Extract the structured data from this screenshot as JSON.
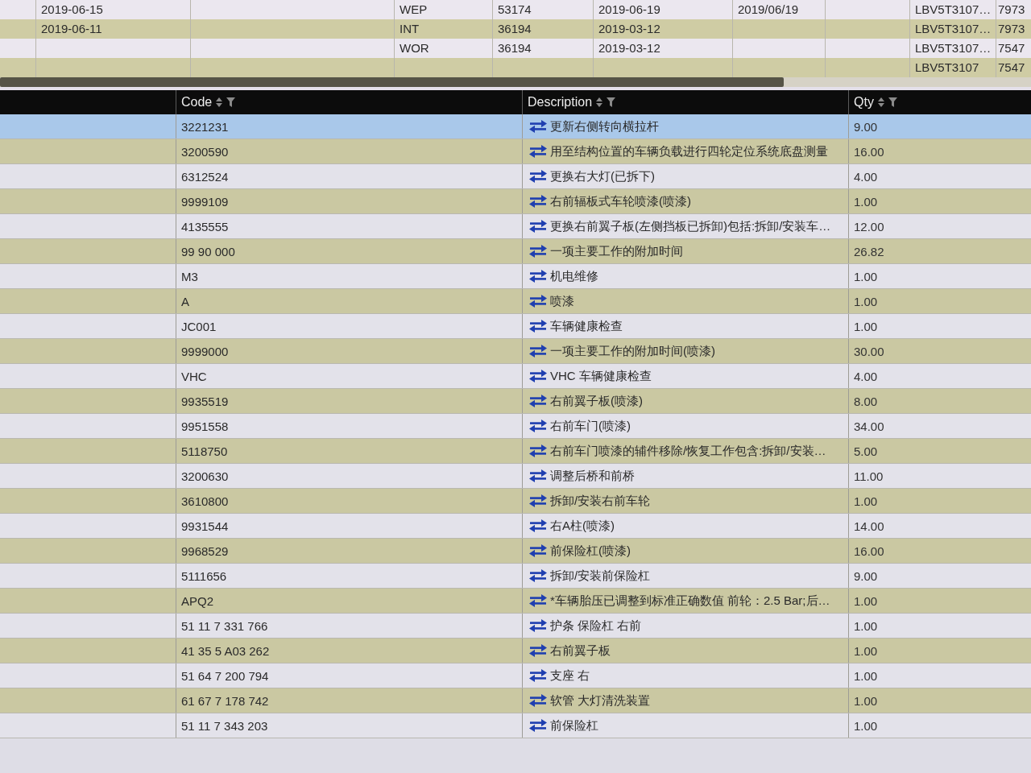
{
  "top_table": {
    "rows": [
      {
        "column_2": "2019-06-15",
        "column_4": "WEP",
        "column_5": "53174",
        "column_6": "2019-06-19",
        "column_7": "2019/06/19",
        "column_9": "LBV5T3107…",
        "column_10": "7973"
      },
      {
        "column_2": "2019-06-11",
        "column_4": "INT",
        "column_5": "36194",
        "column_6": "2019-03-12",
        "column_9": "LBV5T3107…",
        "column_10": "7973"
      },
      {
        "column_4": "WOR",
        "column_5": "36194",
        "column_6": "2019-03-12",
        "column_9": "LBV5T3107…",
        "column_10": "7547"
      },
      {
        "column_9": "LBV5T3107",
        "column_10": "7547"
      }
    ]
  },
  "table": {
    "columns": [
      {
        "label": "Code"
      },
      {
        "label": "Description"
      },
      {
        "label": "Qty"
      }
    ],
    "rows": [
      {
        "code": "3221231",
        "description": "更新右侧转向横拉杆",
        "qty": "9.00",
        "selected": true
      },
      {
        "code": "3200590",
        "description": "用至结构位置的车辆负载进行四轮定位系统底盘测量",
        "qty": "16.00",
        "selected": false
      },
      {
        "code": "6312524",
        "description": "更换右大灯(已拆下)",
        "qty": "4.00",
        "selected": false
      },
      {
        "code": "9999109",
        "description": "右前辐板式车轮喷漆(喷漆)",
        "qty": "1.00",
        "selected": false
      },
      {
        "code": "4135555",
        "description": "更换右前翼子板(左侧挡板已拆卸)包括:拆卸/安装车…",
        "qty": "12.00",
        "selected": false
      },
      {
        "code": "99 90 000",
        "description": "一项主要工作的附加时间",
        "qty": "26.82",
        "selected": false
      },
      {
        "code": "M3",
        "description": "机电维修",
        "qty": "1.00",
        "selected": false
      },
      {
        "code": "A",
        "description": "喷漆",
        "qty": "1.00",
        "selected": false
      },
      {
        "code": "JC001",
        "description": "车辆健康检查",
        "qty": "1.00",
        "selected": false
      },
      {
        "code": "9999000",
        "description": "一项主要工作的附加时间(喷漆)",
        "qty": "30.00",
        "selected": false
      },
      {
        "code": "VHC",
        "description": "VHC 车辆健康检查",
        "qty": "4.00",
        "selected": false
      },
      {
        "code": "9935519",
        "description": "右前翼子板(喷漆)",
        "qty": "8.00",
        "selected": false
      },
      {
        "code": "9951558",
        "description": "右前车门(喷漆)",
        "qty": "34.00",
        "selected": false
      },
      {
        "code": "5118750",
        "description": "右前车门喷漆的辅件移除/恢复工作包含:拆卸/安装…",
        "qty": "5.00",
        "selected": false
      },
      {
        "code": "3200630",
        "description": "调整后桥和前桥",
        "qty": "11.00",
        "selected": false
      },
      {
        "code": "3610800",
        "description": "拆卸/安装右前车轮",
        "qty": "1.00",
        "selected": false
      },
      {
        "code": "9931544",
        "description": "右A柱(喷漆)",
        "qty": "14.00",
        "selected": false
      },
      {
        "code": "9968529",
        "description": "前保险杠(喷漆)",
        "qty": "16.00",
        "selected": false
      },
      {
        "code": "5111656",
        "description": "拆卸/安装前保险杠",
        "qty": "9.00",
        "selected": false
      },
      {
        "code": "APQ2",
        "description": "*车辆胎压已调整到标准正确数值 前轮：2.5 Bar;后…",
        "qty": "1.00",
        "selected": false
      },
      {
        "code": "51 11 7 331 766",
        "description": "护条 保险杠 右前",
        "qty": "1.00",
        "selected": false
      },
      {
        "code": "41 35 5 A03 262",
        "description": "右前翼子板",
        "qty": "1.00",
        "selected": false
      },
      {
        "code": "51 64 7 200 794",
        "description": "支座 右",
        "qty": "1.00",
        "selected": false
      },
      {
        "code": "61 67 7 178 742",
        "description": "软管 大灯清洗装置",
        "qty": "1.00",
        "selected": false
      },
      {
        "code": "51 11 7 343 203",
        "description": "前保险杠",
        "qty": "1.00",
        "selected": false
      }
    ]
  }
}
